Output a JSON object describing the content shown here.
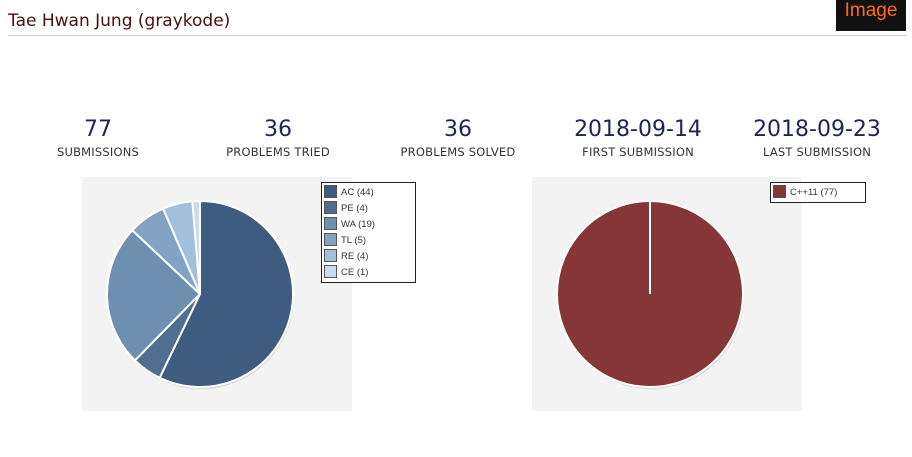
{
  "header": {
    "user_name": "Tae Hwan Jung (graykode)",
    "image_button_label": "Image"
  },
  "stats": [
    {
      "value": "77",
      "label": "SUBMISSIONS"
    },
    {
      "value": "36",
      "label": "PROBLEMS TRIED"
    },
    {
      "value": "36",
      "label": "PROBLEMS SOLVED"
    },
    {
      "value": "2018-09-14",
      "label": "FIRST SUBMISSION"
    },
    {
      "value": "2018-09-23",
      "label": "LAST SUBMISSION"
    }
  ],
  "colors": {
    "title": "#4a0f0f",
    "stat_value": "#1f2456",
    "panel_bg": "#f3f3f3",
    "image_button_bg": "#111111",
    "image_button_text": "#ff6a1a"
  },
  "chart_data": [
    {
      "type": "pie",
      "legend_position": "top-right",
      "slices": [
        {
          "label": "AC (44)",
          "value": 44,
          "color": "#3d5c80"
        },
        {
          "label": "PE (4)",
          "value": 4,
          "color": "#4f6e91"
        },
        {
          "label": "WA (19)",
          "value": 19,
          "color": "#6d8fb0"
        },
        {
          "label": "TL (5)",
          "value": 5,
          "color": "#82a3c4"
        },
        {
          "label": "RE (4)",
          "value": 4,
          "color": "#a2c0de"
        },
        {
          "label": "CE (1)",
          "value": 1,
          "color": "#c7dcf0"
        }
      ]
    },
    {
      "type": "pie",
      "legend_position": "top-right",
      "slices": [
        {
          "label": "C++11 (77)",
          "value": 77,
          "color": "#863636"
        }
      ]
    }
  ]
}
